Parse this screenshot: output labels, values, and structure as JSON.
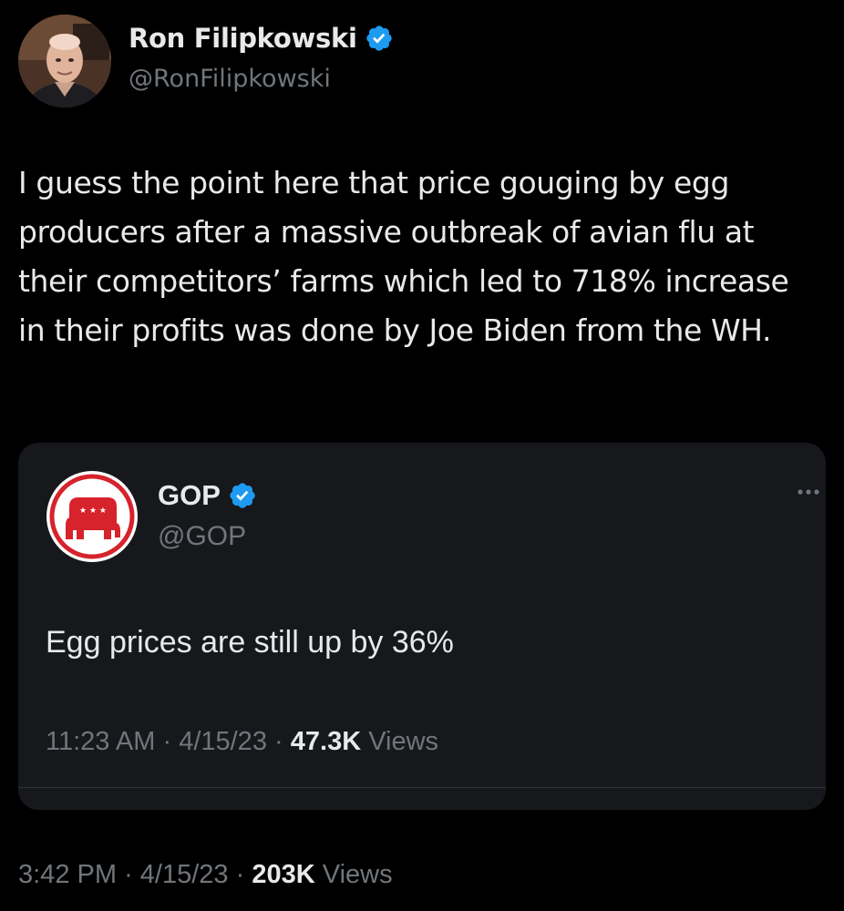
{
  "tweet": {
    "author": {
      "name": "Ron Filipkowski",
      "handle": "@RonFilipkowski",
      "avatar_icon": "person-portrait-avatar",
      "verified_icon": "verified-badge-icon"
    },
    "text": "I guess the point here that price gouging by egg producers after a massive outbreak of avian flu at their competitors’ farms which led to 718% increase in their profits was done by Joe Biden from the WH.",
    "meta": {
      "time": "3:42 PM",
      "separator": "·",
      "date": "4/15/23",
      "views_count": "203K",
      "views_label": "Views"
    }
  },
  "quoted_tweet": {
    "author": {
      "name": "GOP",
      "handle": "@GOP",
      "avatar_icon": "gop-elephant-logo",
      "verified_icon": "verified-badge-icon"
    },
    "more_icon": "more-options-icon",
    "text": "Egg prices are still up by 36%",
    "meta": {
      "time": "11:23 AM",
      "separator": "·",
      "date": "4/15/23",
      "views_count": "47.3K",
      "views_label": "Views"
    }
  },
  "colors": {
    "background": "#000000",
    "card_background": "#16181c",
    "primary_text": "#e7e9ea",
    "secondary_text": "#71767b",
    "verified_blue": "#1d9bf0",
    "gop_red": "#d6232c"
  }
}
